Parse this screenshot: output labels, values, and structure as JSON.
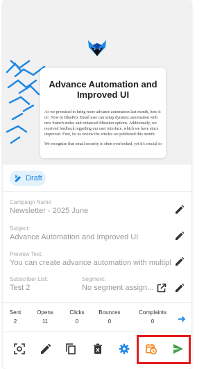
{
  "email": {
    "title": "Advance Automation and Improved UI",
    "paragraph1": "As we promised to bring more advance automation last month, here it is!. Now in BluePox Email user can setup dynamic automation with new branch nodes and enhanced filtration options. Additionally, we received feedback regarding our user interface, which we have since improved. First, let us review the articles we published this month.",
    "paragraph2": "We recognize that email security is often overlooked, yet it's crucial to"
  },
  "status": {
    "label": "Draft"
  },
  "fields": {
    "campaign_name": {
      "label": "Campaign Name",
      "value": "Newsletter - 2025 June"
    },
    "subject": {
      "label": "Subject:",
      "value": "Advance Automation and Improved UI"
    },
    "preview_text": {
      "label": "Preview Text:",
      "value": "You can create advance automation with multipl"
    },
    "subscriber_list": {
      "label": "Subscriber List:",
      "value": "Test 2"
    },
    "segment": {
      "label": "Segment:",
      "value": "No segment assign..."
    }
  },
  "stats": [
    {
      "label": "Sent",
      "value": "2"
    },
    {
      "label": "Opens",
      "value": "11"
    },
    {
      "label": "Clicks",
      "value": "0"
    },
    {
      "label": "Bounces",
      "value": "0"
    },
    {
      "label": "Complaints",
      "value": "0"
    }
  ],
  "colors": {
    "accent_blue": "#1e88e5",
    "send_green": "#43a047",
    "schedule_orange": "#f57c00",
    "highlight_red": "#e51b1b"
  },
  "icons": [
    "fox-logo-icon",
    "draft-pencil-icon",
    "edit-icon",
    "open-in-new-icon",
    "arrow-right-icon",
    "screenshot-icon",
    "copy-icon",
    "delete-icon",
    "settings-icon",
    "schedule-icon",
    "send-icon"
  ]
}
